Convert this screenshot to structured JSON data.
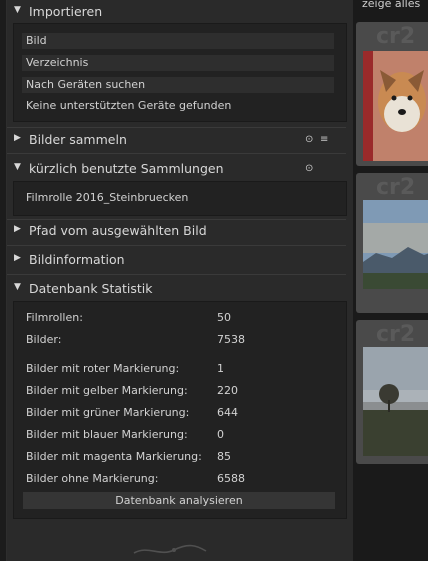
{
  "sections": {
    "import": {
      "title": "Importieren",
      "buttons": [
        "Bild",
        "Verzeichnis",
        "Nach Geräten suchen"
      ],
      "status": "Keine unterstützten Geräte gefunden"
    },
    "collect": {
      "title": "Bilder sammeln",
      "icon_names": [
        "preset-icon",
        "menu-icon"
      ]
    },
    "recent": {
      "title": "kürzlich benutzte Sammlungen",
      "items": [
        "Filmrolle 2016_Steinbruecken"
      ]
    },
    "path": {
      "title": "Pfad vom ausgewählten Bild"
    },
    "info": {
      "title": "Bildinformation"
    },
    "db": {
      "title": "Datenbank Statistik",
      "stats": [
        {
          "label": "Filmrollen:",
          "value": "50"
        },
        {
          "label": "Bilder:",
          "value": "7538"
        },
        {
          "label": "Bilder mit roter Markierung:",
          "value": "1"
        },
        {
          "label": "Bilder mit gelber Markierung:",
          "value": "220"
        },
        {
          "label": "Bilder mit grüner Markierung:",
          "value": "644"
        },
        {
          "label": "Bilder mit blauer Markierung:",
          "value": "0"
        },
        {
          "label": "Bilder mit magenta Markierung:",
          "value": "85"
        },
        {
          "label": "Bilder ohne Markierung:",
          "value": "6588"
        }
      ],
      "analyze_label": "Datenbank analysieren"
    }
  },
  "toolbar": {
    "text": "zeige  alles"
  },
  "thumbnails": [
    {
      "overlay": "cr2",
      "subject": "dog"
    },
    {
      "overlay": "cr2",
      "subject": "landscape-mountains"
    },
    {
      "overlay": "cr2",
      "subject": "tree-field"
    }
  ],
  "colors": {
    "panel_bg": "#2a2a2a",
    "text": "#d2d2d2",
    "thumb_bg": "#4a4a4a"
  }
}
